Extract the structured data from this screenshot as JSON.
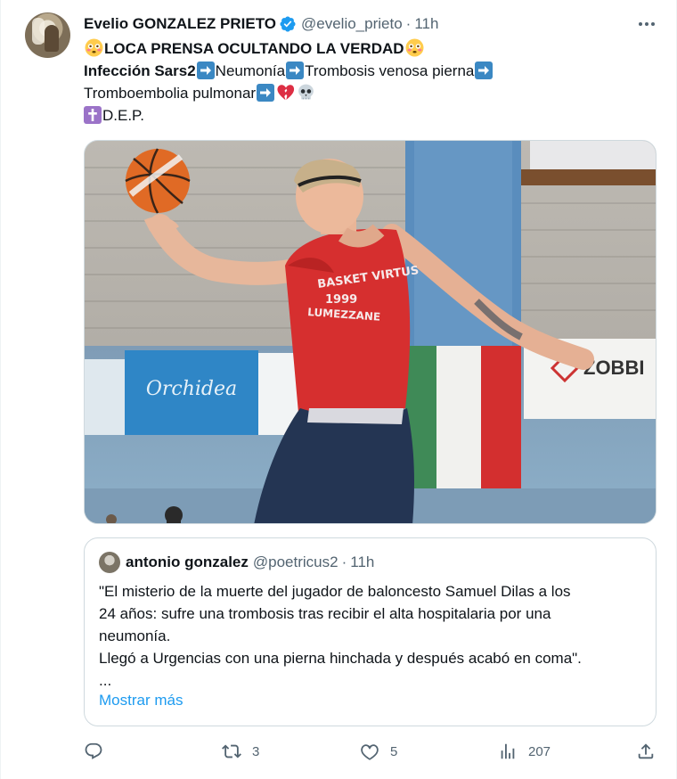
{
  "tweet": {
    "author_name": "Evelio GONZALEZ PRIETO",
    "author_handle": "@evelio_prieto",
    "separator": "·",
    "time": "11h",
    "line1_text": "LOCA PRENSA OCULTANDO LA VERDAD",
    "line2_bold": "Infección Sars2",
    "line2_part2": "Neumonía",
    "line2_part3": "Trombosis venosa pierna",
    "line3_text": "Tromboembolia pulmonar",
    "line4_text": "D.E.P.",
    "media_alt": "Basketball player jumping",
    "jersey_line1": "BASKET VIRTUS",
    "jersey_line2": "1999",
    "jersey_line3": "LUMEZZANE",
    "banner_left": "Orchidea",
    "banner_right": "ZOBBI"
  },
  "quote": {
    "author_name": "antonio gonzalez",
    "author_handle": "@poetricus2",
    "separator": "·",
    "time": "11h",
    "lines": [
      "\"El misterio de la muerte del jugador de baloncesto Samuel Dilas a los",
      "24 años: sufre una trombosis tras recibir el alta hospitalaria por una",
      "neumonía.",
      "Llegó a Urgencias con una pierna hinchada y después acabó en coma\".",
      "..."
    ],
    "show_more": "Mostrar más"
  },
  "actions": {
    "reply_count": "",
    "retweet_count": "3",
    "like_count": "5",
    "views_count": "207"
  },
  "colors": {
    "link": "#1d9bf0",
    "secondary": "#536471",
    "verified": "#1d9bf0",
    "arrow_emoji": "#3b88c3"
  },
  "icons": [
    "verified-badge-icon",
    "more-icon",
    "flushed-face-icon",
    "right-arrow-icon",
    "broken-heart-icon",
    "skull-icon",
    "cross-icon",
    "reply-icon",
    "retweet-icon",
    "like-icon",
    "views-icon",
    "share-icon"
  ]
}
